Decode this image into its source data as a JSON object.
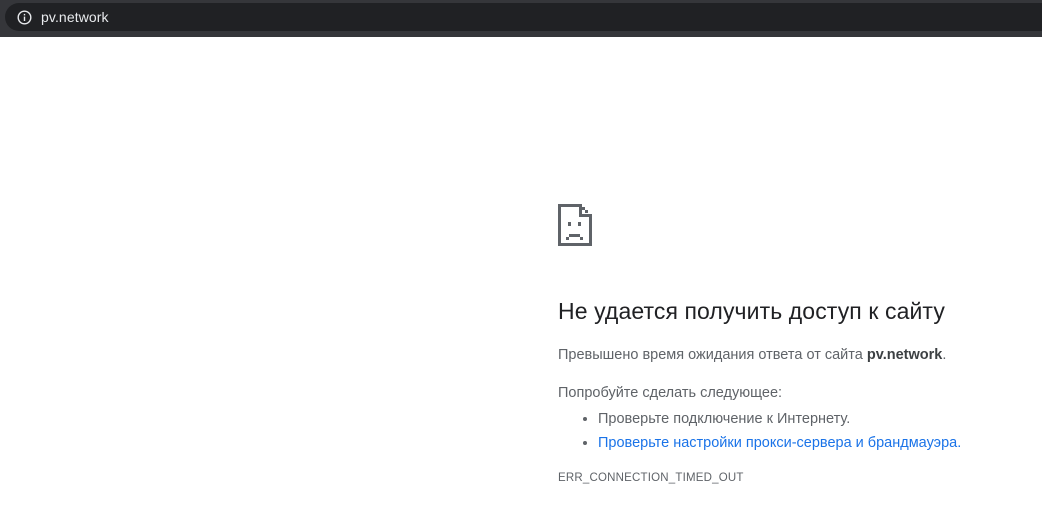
{
  "address_bar": {
    "icon": "info-icon",
    "url": "pv.network"
  },
  "error_page": {
    "icon": "sad-page-icon",
    "heading": "Не удается получить доступ к сайту",
    "description_prefix": "Превышено время ожидания ответа от сайта ",
    "description_host": "pv.network",
    "description_suffix": ".",
    "try_label": "Попробуйте сделать следующее:",
    "suggestions": [
      "Проверьте подключение к Интернету.",
      "Проверьте настройки прокси-сервера и брандмауэра."
    ],
    "error_code": "ERR_CONNECTION_TIMED_OUT"
  },
  "colors": {
    "toolbar_bg": "#35363a",
    "omnibox_bg": "#202124",
    "link": "#1a73e8",
    "text_secondary": "#5f6368",
    "heading_text": "#202124"
  }
}
